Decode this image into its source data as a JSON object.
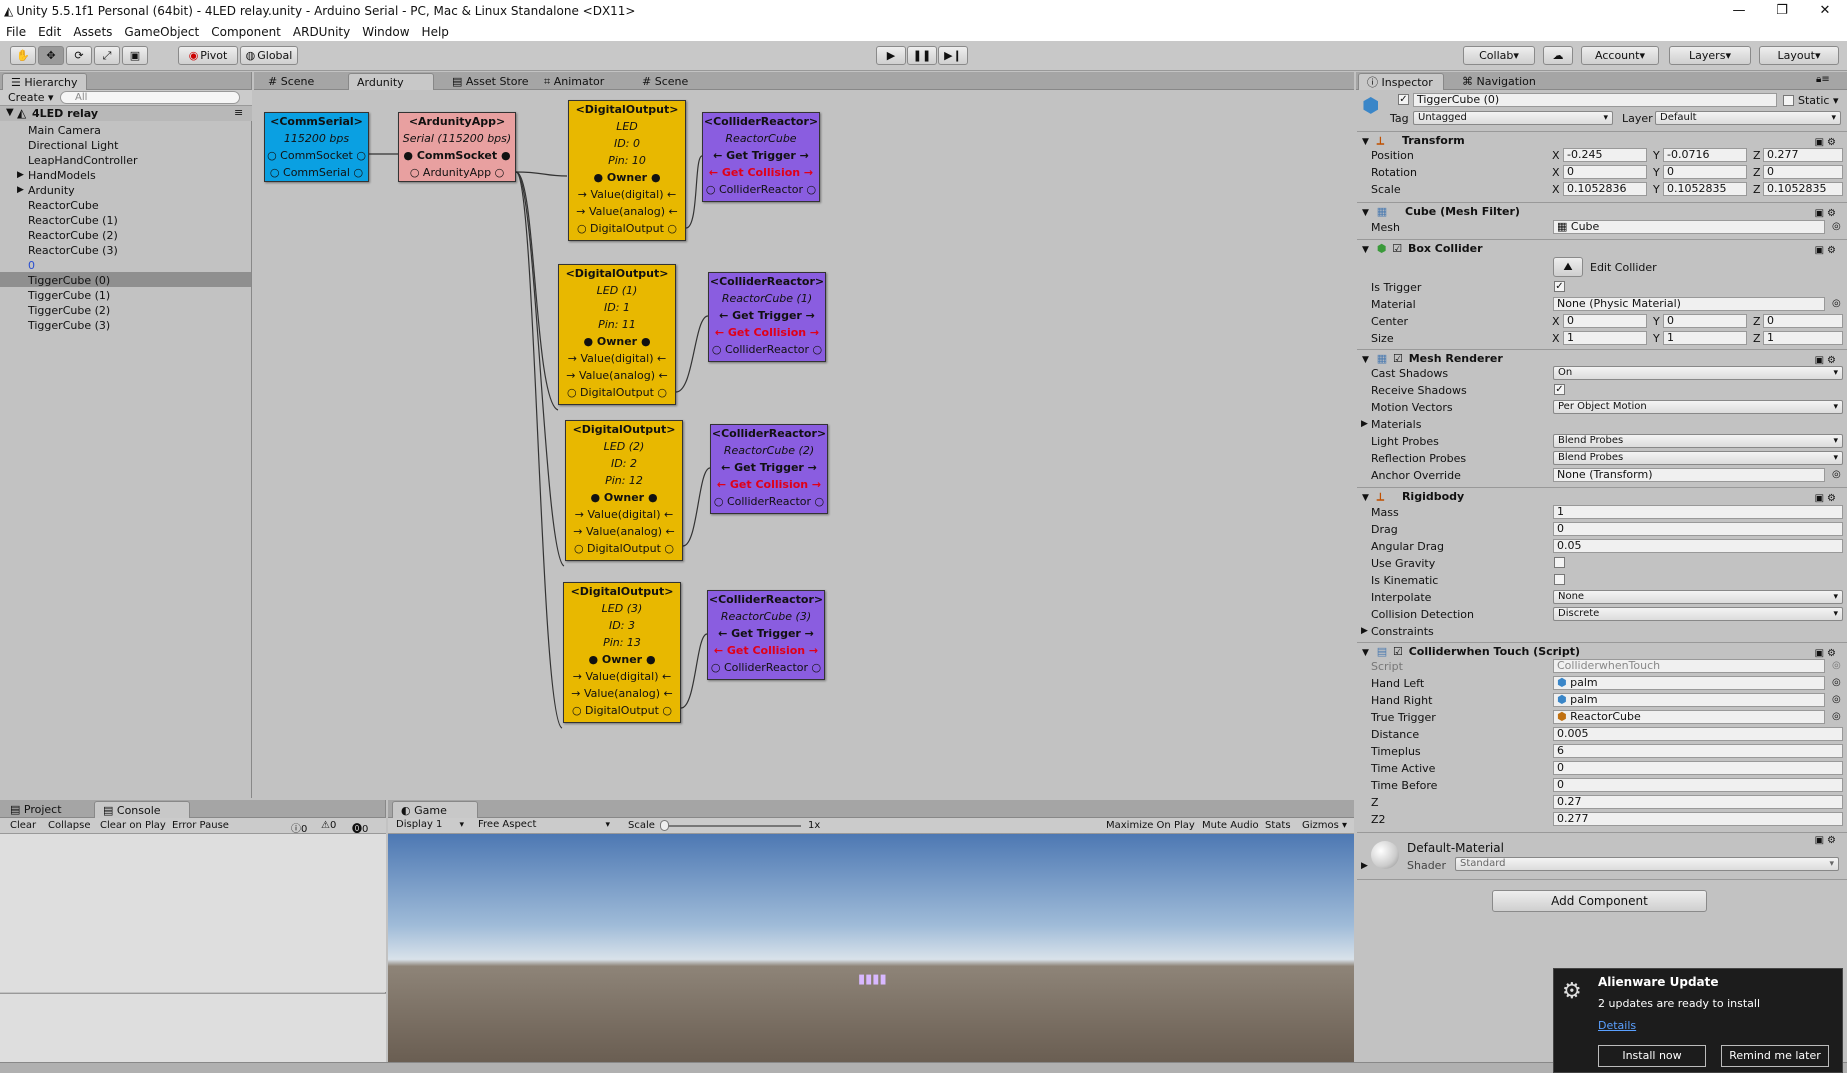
{
  "window": {
    "title": "Unity 5.5.1f1 Personal (64bit) - 4LED relay.unity - Arduino Serial - PC, Mac & Linux Standalone <DX11>",
    "min": "—",
    "max": "❐",
    "close": "✕"
  },
  "menu": [
    "File",
    "Edit",
    "Assets",
    "GameObject",
    "Component",
    "ARDUnity",
    "Window",
    "Help"
  ],
  "toolbar": {
    "pivot": "Pivot",
    "global": "Global",
    "collab": "Collab",
    "account": "Account",
    "layers": "Layers",
    "layout": "Layout"
  },
  "hierarchy": {
    "tab": "Hierarchy",
    "create": "Create",
    "search_placeholder": "All",
    "scene": "4LED relay",
    "items": [
      "Main Camera",
      "Directional Light",
      "LeapHandController",
      "HandModels",
      "Ardunity",
      "ReactorCube",
      "ReactorCube (1)",
      "ReactorCube (2)",
      "ReactorCube (3)",
      "0",
      "TiggerCube (0)",
      "TiggerCube (1)",
      "TiggerCube (2)",
      "TiggerCube (3)"
    ]
  },
  "center_tabs": [
    "Scene",
    "Ardunity",
    "Asset Store",
    "Animator",
    "Scene"
  ],
  "nodes": {
    "comm": {
      "title": "<CommSerial>",
      "sub": "115200 bps",
      "r1": "○ CommSocket ○",
      "r2": "○ CommSerial ○"
    },
    "app": {
      "title": "<ArdunityApp>",
      "sub": "Serial (115200 bps)",
      "r1": "● CommSocket ●",
      "r2": "○ ArdunityApp ○"
    },
    "digital": [
      {
        "title": "<DigitalOutput>",
        "sub": "LED",
        "id": "ID: 0",
        "pin": "Pin: 10"
      },
      {
        "title": "<DigitalOutput>",
        "sub": "LED (1)",
        "id": "ID: 1",
        "pin": "Pin: 11"
      },
      {
        "title": "<DigitalOutput>",
        "sub": "LED (2)",
        "id": "ID: 2",
        "pin": "Pin: 12"
      },
      {
        "title": "<DigitalOutput>",
        "sub": "LED (3)",
        "id": "ID: 3",
        "pin": "Pin: 13"
      }
    ],
    "digital_rows": {
      "owner": "● Owner ●",
      "vd": "→ Value(digital) ←",
      "va": "→ Value(analog) ←",
      "out": "○ DigitalOutput ○"
    },
    "collider": [
      {
        "title": "<ColliderReactor>",
        "sub": "ReactorCube"
      },
      {
        "title": "<ColliderReactor>",
        "sub": "ReactorCube (1)"
      },
      {
        "title": "<ColliderReactor>",
        "sub": "ReactorCube (2)"
      },
      {
        "title": "<ColliderReactor>",
        "sub": "ReactorCube (3)"
      }
    ],
    "collider_rows": {
      "trigger": "← Get Trigger →",
      "collision": "← Get Collision →",
      "out": "○ ColliderReactor ○"
    }
  },
  "bottom_left": {
    "tabs": [
      "Project",
      "Console"
    ],
    "buttons": [
      "Clear",
      "Collapse",
      "Clear on Play",
      "Error Pause"
    ],
    "counts": [
      "0",
      "0",
      "0"
    ]
  },
  "game": {
    "tab": "Game",
    "display": "Display 1",
    "aspect": "Free Aspect",
    "scale_label": "Scale",
    "scale_val": "1x",
    "buttons": [
      "Maximize On Play",
      "Mute Audio",
      "Stats",
      "Gizmos"
    ]
  },
  "inspector": {
    "tabs": [
      "Inspector",
      "Navigation"
    ],
    "object_name": "TiggerCube (0)",
    "static": "Static",
    "tag_label": "Tag",
    "tag": "Untagged",
    "layer_label": "Layer",
    "layer": "Default",
    "transform": {
      "title": "Transform",
      "rows": [
        {
          "label": "Position",
          "x": "-0.245",
          "y": "-0.0716",
          "z": "0.277"
        },
        {
          "label": "Rotation",
          "x": "0",
          "y": "0",
          "z": "0"
        },
        {
          "label": "Scale",
          "x": "0.1052836",
          "y": "0.1052835",
          "z": "0.1052835"
        }
      ]
    },
    "meshfilter": {
      "title": "Cube (Mesh Filter)",
      "mesh_label": "Mesh",
      "mesh": "Cube"
    },
    "boxcollider": {
      "title": "Box Collider",
      "edit": "Edit Collider",
      "trigger_label": "Is Trigger",
      "material_label": "Material",
      "material": "None (Physic Material)",
      "center_label": "Center",
      "cx": "0",
      "cy": "0",
      "cz": "0",
      "size_label": "Size",
      "sx": "1",
      "sy": "1",
      "sz": "1"
    },
    "meshrenderer": {
      "title": "Mesh Renderer",
      "rows": [
        {
          "label": "Cast Shadows",
          "value": "On",
          "kind": "drop"
        },
        {
          "label": "Receive Shadows",
          "value": "✓",
          "kind": "check"
        },
        {
          "label": "Motion Vectors",
          "value": "Per Object Motion",
          "kind": "drop"
        },
        {
          "label": "Materials",
          "value": "",
          "kind": "fold"
        },
        {
          "label": "Light Probes",
          "value": "Blend Probes",
          "kind": "drop"
        },
        {
          "label": "Reflection Probes",
          "value": "Blend Probes",
          "kind": "drop"
        },
        {
          "label": "Anchor Override",
          "value": "None (Transform)",
          "kind": "field"
        }
      ]
    },
    "rigidbody": {
      "title": "Rigidbody",
      "rows": [
        {
          "label": "Mass",
          "value": "1",
          "kind": "field"
        },
        {
          "label": "Drag",
          "value": "0",
          "kind": "field"
        },
        {
          "label": "Angular Drag",
          "value": "0.05",
          "kind": "field"
        },
        {
          "label": "Use Gravity",
          "value": "",
          "kind": "check"
        },
        {
          "label": "Is Kinematic",
          "value": "",
          "kind": "check"
        },
        {
          "label": "Interpolate",
          "value": "None",
          "kind": "drop"
        },
        {
          "label": "Collision Detection",
          "value": "Discrete",
          "kind": "drop"
        },
        {
          "label": "Constraints",
          "value": "",
          "kind": "fold"
        }
      ]
    },
    "script": {
      "title": "Colliderwhen Touch (Script)",
      "rows": [
        {
          "label": "Script",
          "value": "ColliderwhenTouch"
        },
        {
          "label": "Hand Left",
          "value": "palm"
        },
        {
          "label": "Hand Right",
          "value": "palm"
        },
        {
          "label": "True Trigger",
          "value": "ReactorCube"
        },
        {
          "label": "Distance",
          "value": "0.005"
        },
        {
          "label": "Timeplus",
          "value": "6"
        },
        {
          "label": "Time Active",
          "value": "0"
        },
        {
          "label": "Time Before",
          "value": "0"
        },
        {
          "label": "Z",
          "value": "0.27"
        },
        {
          "label": "Z2",
          "value": "0.277"
        }
      ]
    },
    "material": {
      "name": "Default-Material",
      "shader_label": "Shader",
      "shader": "Standard"
    },
    "add_component": "Add Component"
  },
  "toast": {
    "title": "Alienware Update",
    "body": "2 updates are ready to install",
    "link": "Details",
    "install": "Install now",
    "remind": "Remind me later"
  }
}
